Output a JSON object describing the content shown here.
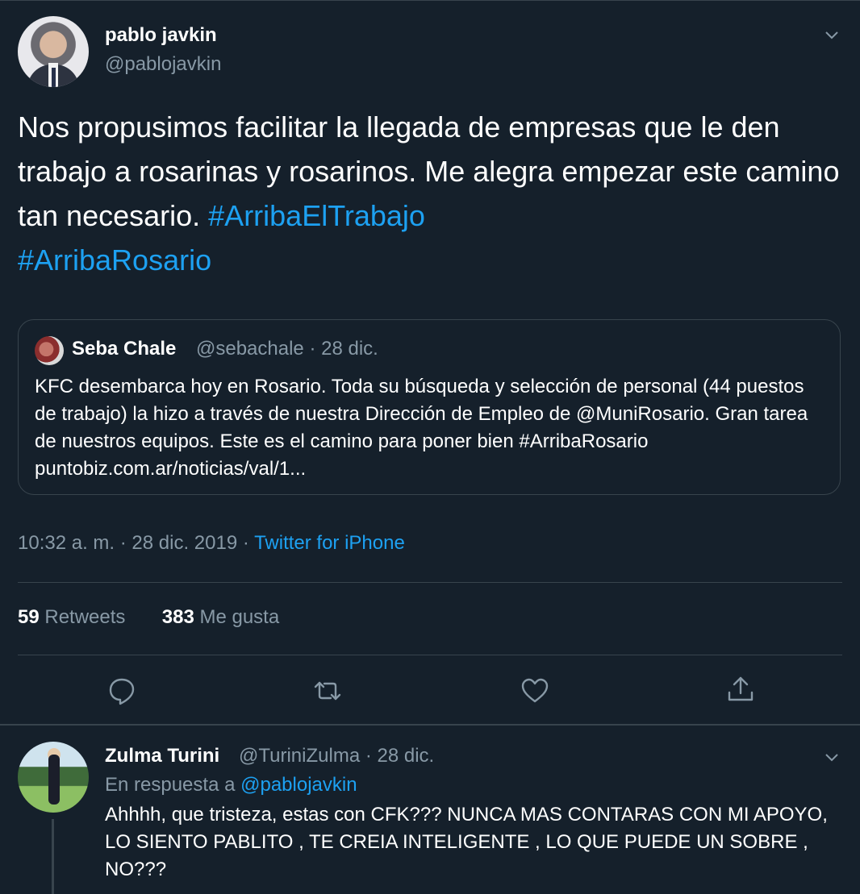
{
  "tweet": {
    "author_name": "pablo javkin",
    "author_handle": "@pablojavkin",
    "text_plain": "Nos propusimos facilitar la llegada de empresas que le den trabajo a rosarinas y rosarinos. Me alegra empezar este camino tan necesario. ",
    "hashtag_1": "#ArribaElTrabajo",
    "hashtag_2": "#ArribaRosario",
    "quoted": {
      "author_name": "Seba Chale",
      "meta": "@sebachale · 28 dic.",
      "text": "KFC desembarca hoy en Rosario. Toda su búsqueda y selección de personal (44 puestos de trabajo) la hizo a través de nuestra Dirección de Empleo de @MuniRosario. Gran tarea de nuestros equipos. Este es el camino para poner bien #ArribaRosario puntobiz.com.ar/noticias/val/1..."
    },
    "timestamp": "10:32 a. m. · 28 dic. 2019 · ",
    "source": "Twitter for iPhone",
    "retweets_count": "59",
    "retweets_label": " Retweets",
    "likes_count": "383",
    "likes_label": " Me gusta"
  },
  "reply": {
    "author_name": "Zulma Turini",
    "meta": "@TuriniZulma · 28 dic.",
    "reply_to_prefix": "En respuesta a ",
    "reply_to_handle": "@pablojavkin",
    "text": "Ahhhh, que tristeza, estas con CFK??? NUNCA MAS CONTARAS CON MI APOYO, LO SIENTO PABLITO , TE CREIA INTELIGENTE , LO QUE PUEDE UN SOBRE , NO???"
  },
  "icons": [
    "chevron-down-icon",
    "reply-icon",
    "retweet-icon",
    "like-icon",
    "share-icon"
  ],
  "colors": {
    "background": "#15202b",
    "accent": "#1da1f2",
    "secondary_text": "#8899a6",
    "divider": "#38444d"
  }
}
